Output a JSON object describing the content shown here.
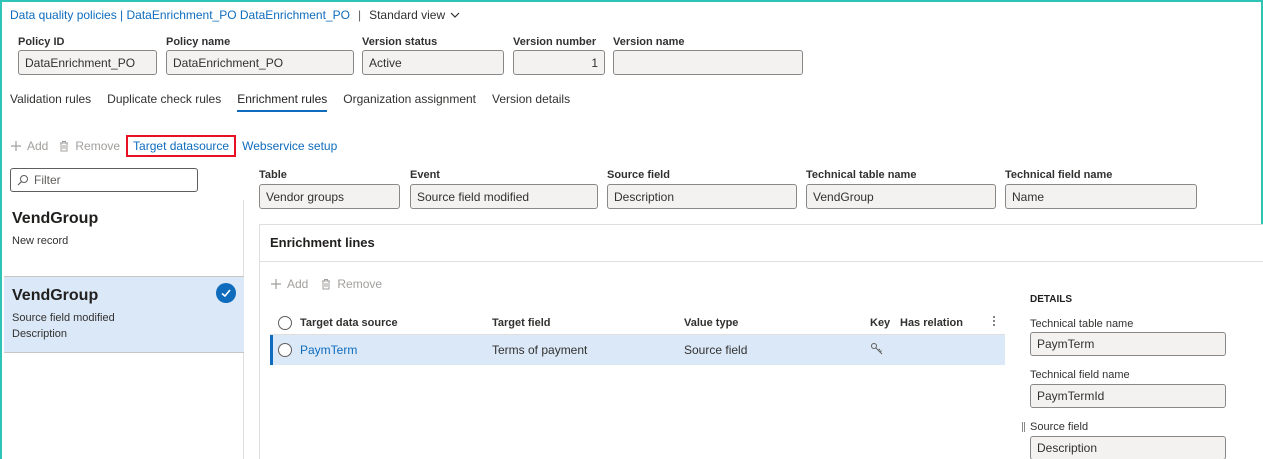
{
  "title": {
    "breadcrumb": "Data quality policies | DataEnrichment_PO DataEnrichment_PO",
    "separator": "|",
    "view": "Standard view"
  },
  "header": {
    "policy_id": {
      "label": "Policy ID",
      "value": "DataEnrichment_PO"
    },
    "policy_name": {
      "label": "Policy name",
      "value": "DataEnrichment_PO"
    },
    "version_status": {
      "label": "Version status",
      "value": "Active"
    },
    "version_number": {
      "label": "Version number",
      "value": "1"
    },
    "version_name": {
      "label": "Version name",
      "value": ""
    }
  },
  "tabs": [
    {
      "label": "Validation rules"
    },
    {
      "label": "Duplicate check rules"
    },
    {
      "label": "Enrichment rules",
      "active": true
    },
    {
      "label": "Organization assignment"
    },
    {
      "label": "Version details"
    }
  ],
  "actions": {
    "add": "Add",
    "remove": "Remove",
    "target_datasource": "Target datasource",
    "webservice_setup": "Webservice setup"
  },
  "filter": {
    "placeholder": "Filter"
  },
  "records": [
    {
      "name": "VendGroup",
      "line1": "New record",
      "line2": ""
    },
    {
      "name": "VendGroup",
      "line1": "Source field modified",
      "line2": "Description",
      "selected": true
    }
  ],
  "rule_fields": {
    "table": {
      "label": "Table",
      "value": "Vendor groups"
    },
    "event": {
      "label": "Event",
      "value": "Source field modified"
    },
    "source_field": {
      "label": "Source field",
      "value": "Description"
    },
    "technical_table_name": {
      "label": "Technical table name",
      "value": "VendGroup"
    },
    "technical_field_name": {
      "label": "Technical field name",
      "value": "Name"
    }
  },
  "enrichment_lines": {
    "title": "Enrichment lines",
    "add": "Add",
    "remove": "Remove",
    "columns": {
      "target_data_source": "Target data source",
      "target_field": "Target field",
      "value_type": "Value type",
      "key": "Key",
      "has_relation": "Has relation"
    },
    "rows": [
      {
        "target_data_source": "PaymTerm",
        "target_field": "Terms of payment",
        "value_type": "Source field"
      }
    ]
  },
  "details": {
    "header": "DETAILS",
    "technical_table_name": {
      "label": "Technical table name",
      "value": "PaymTerm"
    },
    "technical_field_name": {
      "label": "Technical field name",
      "value": "PaymTermId"
    },
    "source_field": {
      "label": "Source field",
      "value": "Description"
    }
  },
  "colors": {
    "accent": "#0f6cbd",
    "selected_bg": "#dbe8f7",
    "highlight_border": "#e81123",
    "frame": "#2ec4b6"
  },
  "icons": {
    "add": "plus-icon",
    "remove": "trash-icon",
    "filter": "search-icon",
    "view": "chevron-down-icon",
    "check": "checkmark-icon",
    "key": "key-icon",
    "more": "more-vertical-icon"
  }
}
